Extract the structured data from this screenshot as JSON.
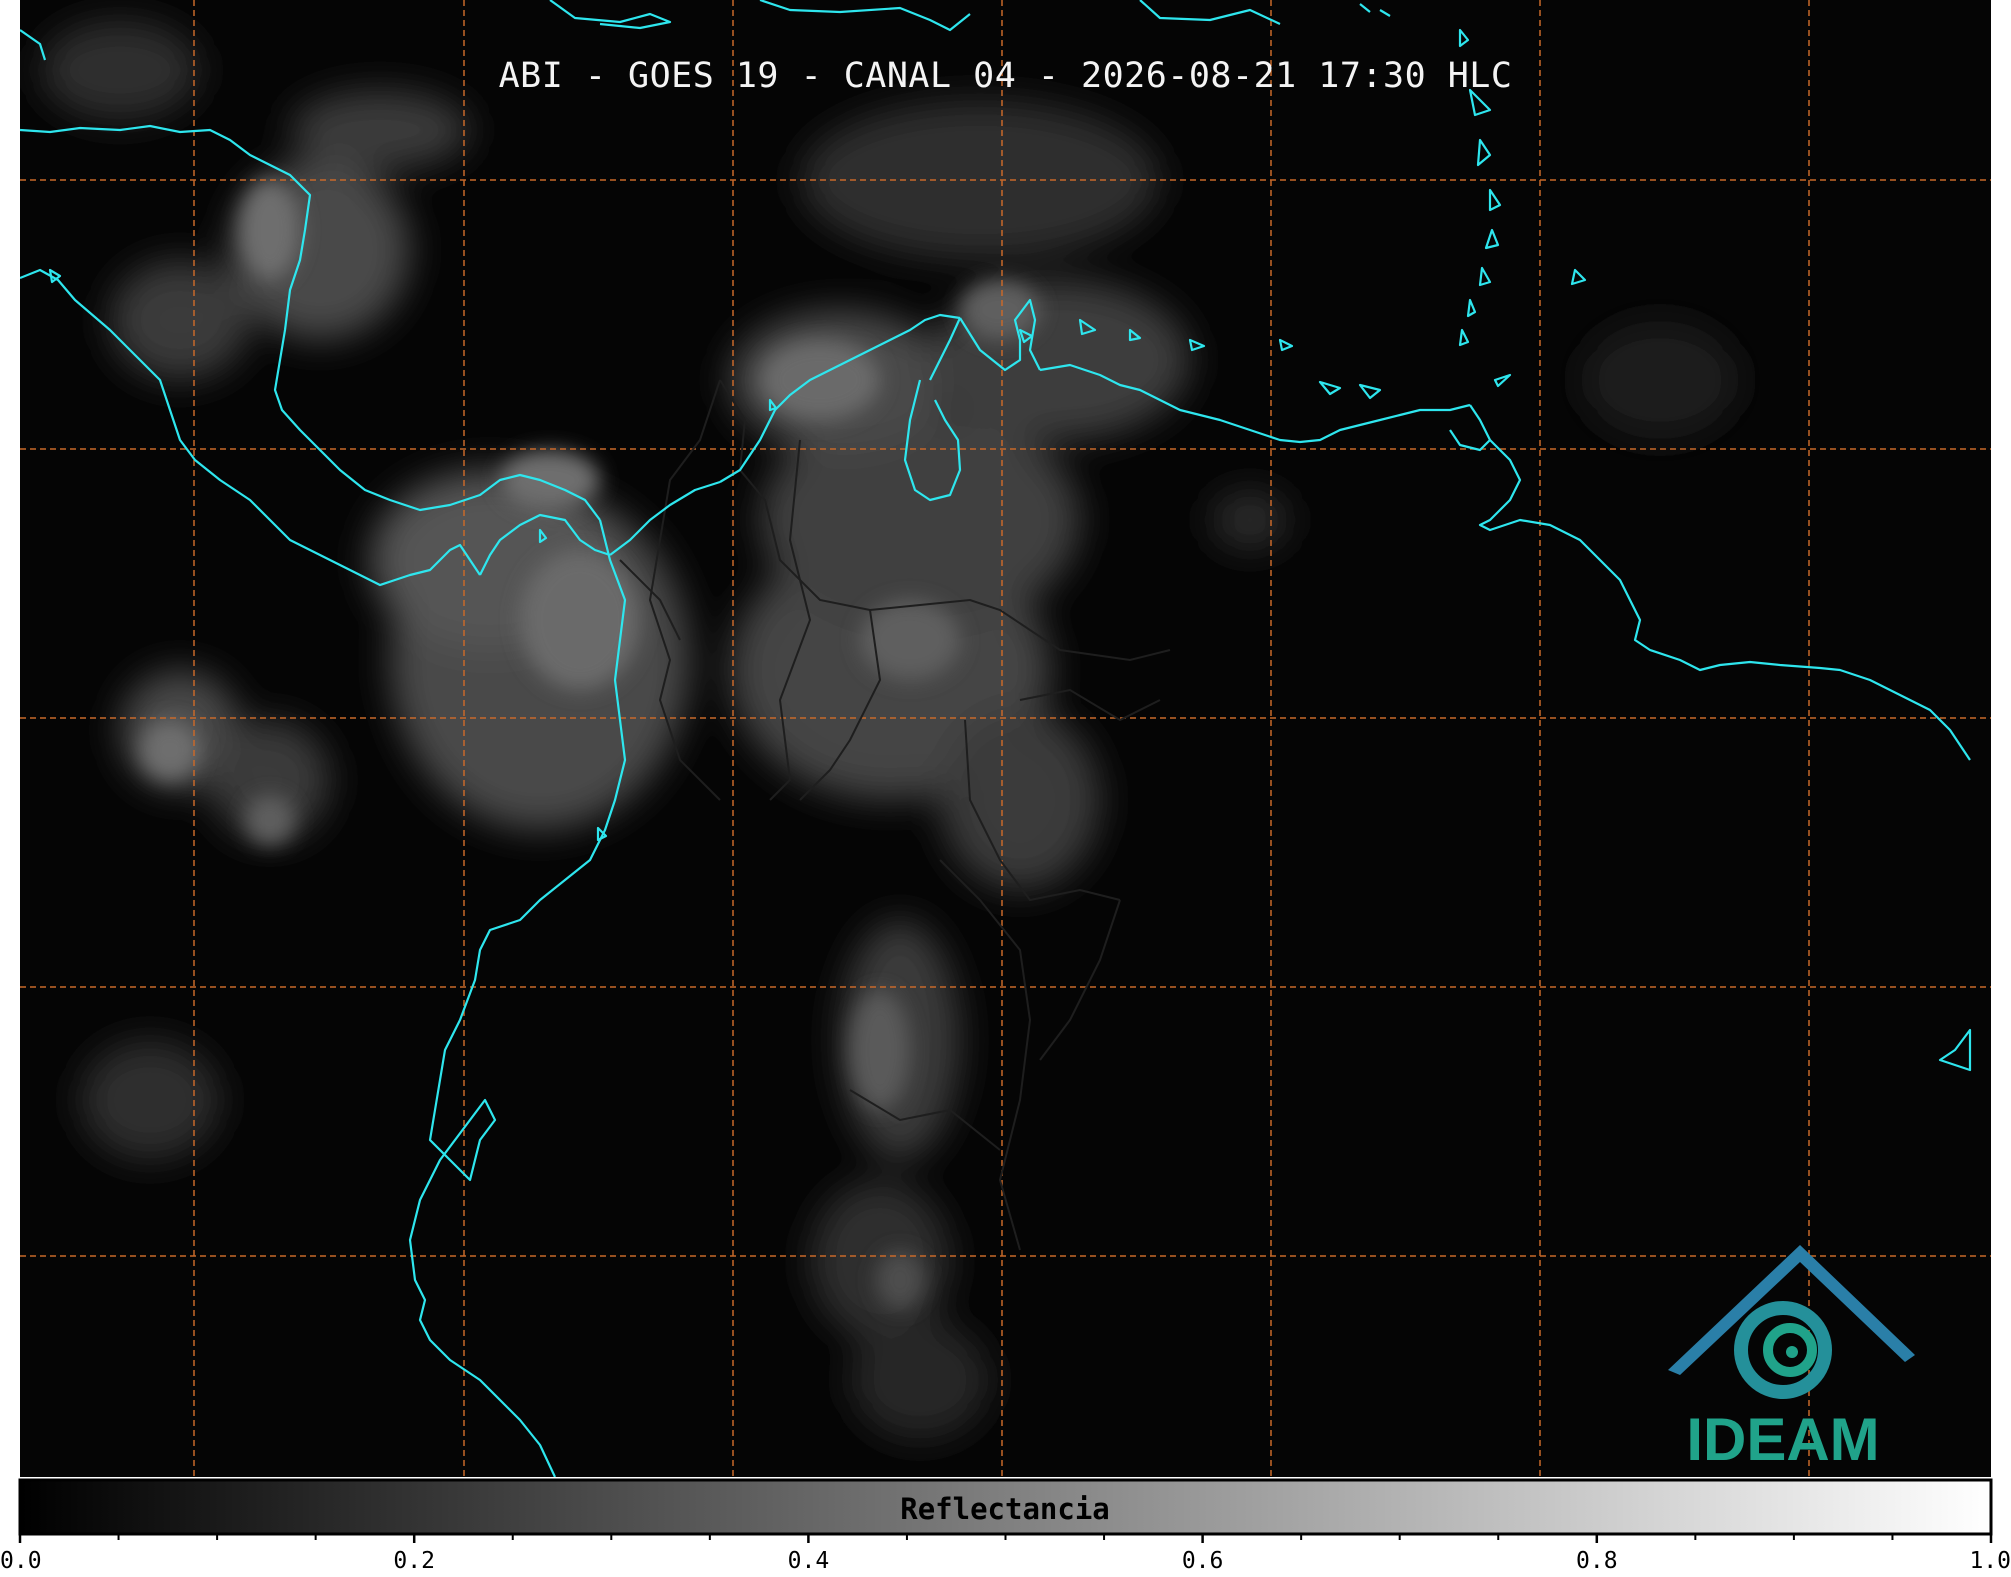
{
  "title": "ABI - GOES 19 - CANAL 04 - 2026-08-21 17:30 HLC",
  "colors": {
    "background": "#050505",
    "coastline": "#2ee6ee",
    "borders": "#1e1e1e",
    "grid": "#c8692a",
    "logo_primary": "#2a7fa8",
    "logo_secondary": "#20a38a"
  },
  "logo": {
    "text": "IDEAM"
  },
  "colorbar": {
    "label": "Reflectancia",
    "colormap": "gray",
    "range": [
      0.0,
      1.0
    ],
    "major_ticks": [
      "0.0",
      "0.2",
      "0.4",
      "0.6",
      "0.8",
      "1.0"
    ],
    "minor_tick_step": 0.05
  },
  "map": {
    "layers": [
      "cloud-reflectance",
      "coastlines",
      "country-borders",
      "lat-lon-grid"
    ],
    "grid_style": "dashed"
  }
}
